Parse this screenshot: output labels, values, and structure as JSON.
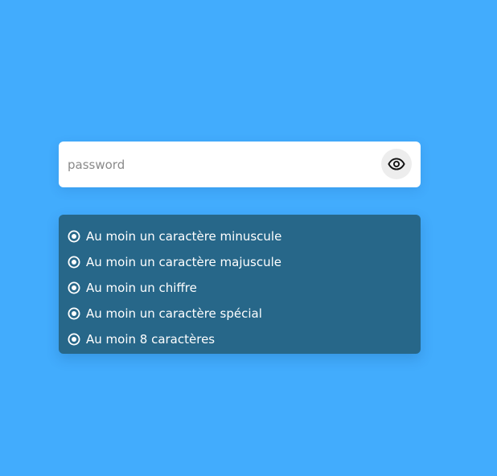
{
  "password": {
    "placeholder": "password",
    "value": "",
    "toggle_icon": "eye-icon"
  },
  "rules": {
    "icon": "radio-checked-icon",
    "items": [
      {
        "label": "Au moin un caractère minuscule"
      },
      {
        "label": "Au moin un caractère majuscule"
      },
      {
        "label": "Au moin un chiffre"
      },
      {
        "label": "Au moin un caractère spécial"
      },
      {
        "label": "Au moin 8 caractères"
      }
    ]
  },
  "colors": {
    "background": "#42acfd",
    "panel": "#276789",
    "input_background": "#ffffff",
    "eye_button_background": "#ededed",
    "text_light": "#ffffff"
  }
}
